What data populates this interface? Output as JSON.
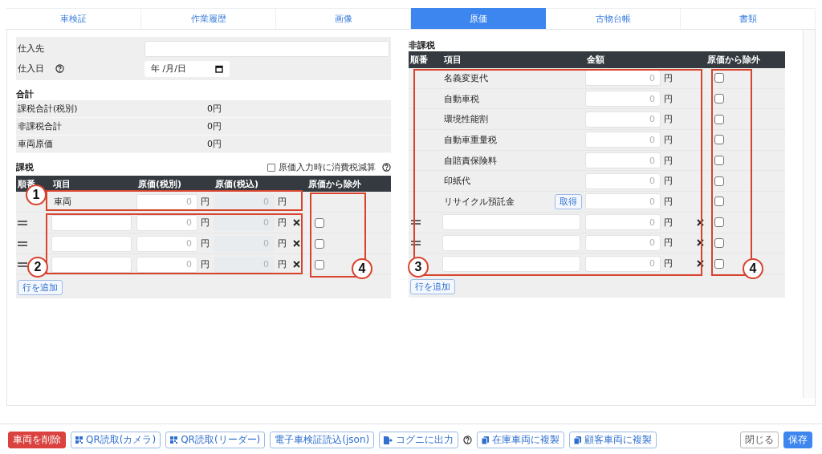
{
  "tabs": [
    {
      "label": "車検証",
      "selected": false
    },
    {
      "label": "作業履歴",
      "selected": false
    },
    {
      "label": "画像",
      "selected": false
    },
    {
      "label": "原価",
      "selected": true
    },
    {
      "label": "古物台帳",
      "selected": false
    },
    {
      "label": "書類",
      "selected": false
    }
  ],
  "purchase_form": {
    "rows": [
      {
        "kind": "text",
        "label": "仕入先"
      },
      {
        "kind": "date",
        "label": "仕入日",
        "placeholder": "年 /月/日"
      }
    ]
  },
  "totals": {
    "title": "合計",
    "rows": [
      {
        "label": "課税合計(税別)",
        "value": "0円"
      },
      {
        "label": "非課税合計",
        "value": "0円"
      },
      {
        "label": "車両原価",
        "value": "0円"
      }
    ]
  },
  "taxable": {
    "title": "課税",
    "option": {
      "label": "原価入力時に消費税減算",
      "checked": false
    },
    "columns": [
      "順番",
      "項目",
      "原価(税別)",
      "原価(税込)",
      "原価から除外"
    ],
    "rows": [
      {
        "kind": "vehicle",
        "item": "車両",
        "price_ex": {
          "placeholder": "0",
          "unit": "円"
        },
        "price_in": {
          "placeholder": "0",
          "unit": "円",
          "disabled": true
        }
      },
      {
        "kind": "custom",
        "price_ex": {
          "placeholder": "0",
          "unit": "円"
        },
        "price_in": {
          "placeholder": "0",
          "unit": "円",
          "disabled": true
        },
        "excluded": false
      },
      {
        "kind": "custom",
        "price_ex": {
          "placeholder": "0",
          "unit": "円"
        },
        "price_in": {
          "placeholder": "0",
          "unit": "円",
          "disabled": true
        },
        "excluded": false
      },
      {
        "kind": "custom",
        "price_ex": {
          "placeholder": "0",
          "unit": "円"
        },
        "price_in": {
          "placeholder": "0",
          "unit": "円",
          "disabled": true
        },
        "excluded": false
      }
    ],
    "add_button": "行を追加"
  },
  "nontaxable": {
    "title": "非課税",
    "columns": [
      "順番",
      "項目",
      "金額",
      "原価から除外"
    ],
    "rows": [
      {
        "kind": "fixed",
        "item": "名義変更代",
        "amount": {
          "placeholder": "0",
          "unit": "円"
        },
        "excluded": false
      },
      {
        "kind": "fixed",
        "item": "自動車税",
        "amount": {
          "placeholder": "0",
          "unit": "円"
        },
        "excluded": false
      },
      {
        "kind": "fixed",
        "item": "環境性能割",
        "amount": {
          "placeholder": "0",
          "unit": "円"
        },
        "excluded": false
      },
      {
        "kind": "fixed",
        "item": "自動車重量税",
        "amount": {
          "placeholder": "0",
          "unit": "円"
        },
        "excluded": false
      },
      {
        "kind": "fixed",
        "item": "自賠責保険料",
        "amount": {
          "placeholder": "0",
          "unit": "円"
        },
        "excluded": false
      },
      {
        "kind": "fixed",
        "item": "印紙代",
        "amount": {
          "placeholder": "0",
          "unit": "円"
        },
        "excluded": false
      },
      {
        "kind": "fixed",
        "item": "リサイクル預託金",
        "action": "取得",
        "amount": {
          "placeholder": "0",
          "unit": "円"
        },
        "excluded": false
      },
      {
        "kind": "custom",
        "amount": {
          "placeholder": "0",
          "unit": "円"
        },
        "excluded": false
      },
      {
        "kind": "custom",
        "amount": {
          "placeholder": "0",
          "unit": "円"
        },
        "excluded": false
      },
      {
        "kind": "custom",
        "amount": {
          "placeholder": "0",
          "unit": "円"
        },
        "excluded": false
      }
    ],
    "add_button": "行を追加"
  },
  "footer": {
    "left_buttons": [
      {
        "label": "車両を削除",
        "kind": "danger"
      },
      {
        "label": "QR読取(カメラ)",
        "kind": "outline"
      },
      {
        "label": "QR読取(リーダー)",
        "kind": "outline"
      },
      {
        "label": "電子車検証読込(json)",
        "kind": "outline"
      },
      {
        "label": "コグニに出力",
        "kind": "outline"
      },
      {
        "label": "在庫車両に複製",
        "kind": "outline"
      },
      {
        "label": "顧客車両に複製",
        "kind": "outline"
      }
    ],
    "right_buttons": [
      {
        "label": "閉じる",
        "kind": "secondary"
      },
      {
        "label": "保存",
        "kind": "primary"
      }
    ]
  },
  "annotations": [
    {
      "number": "1"
    },
    {
      "number": "2"
    },
    {
      "number": "4"
    },
    {
      "number": "3"
    },
    {
      "number": "4"
    }
  ]
}
